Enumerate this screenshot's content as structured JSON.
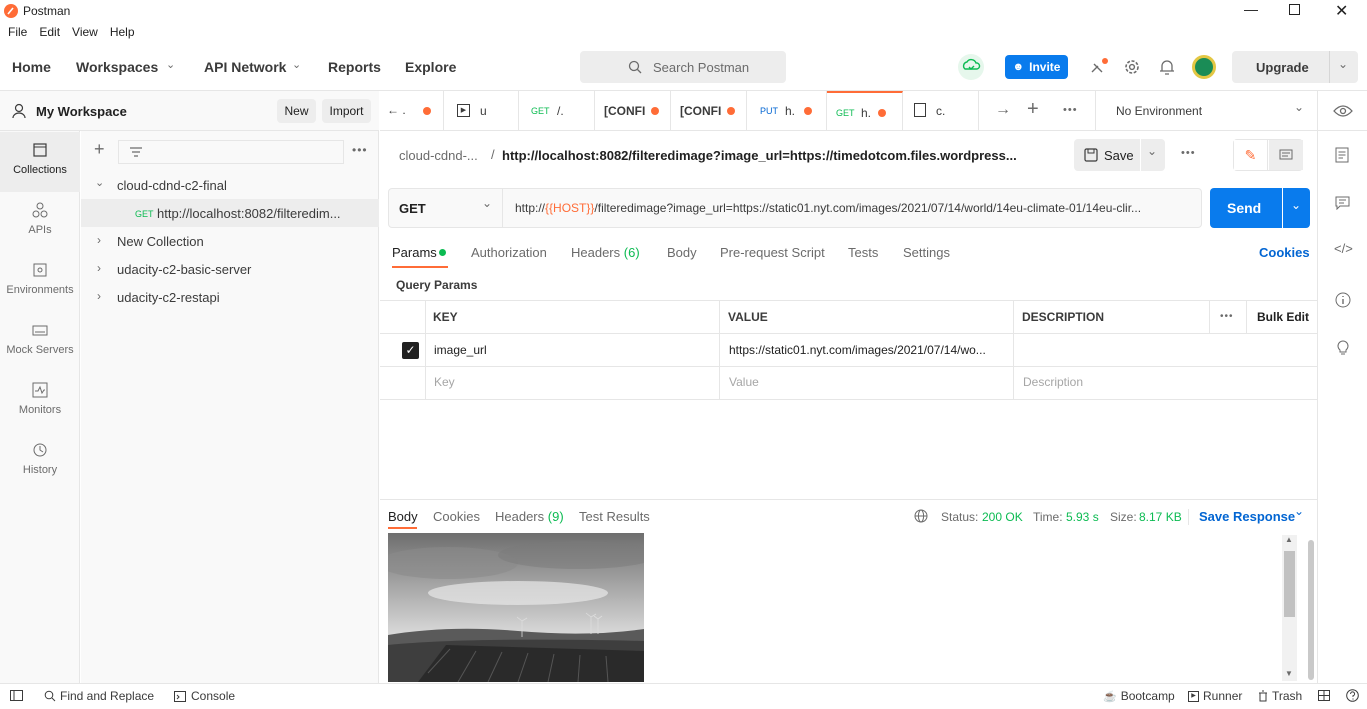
{
  "window": {
    "title": "Postman"
  },
  "menu": [
    "File",
    "Edit",
    "View",
    "Help"
  ],
  "nav": {
    "home": "Home",
    "workspaces": "Workspaces",
    "api_network": "API Network",
    "reports": "Reports",
    "explore": "Explore",
    "search_placeholder": "Search Postman",
    "invite": "Invite",
    "upgrade": "Upgrade"
  },
  "sidebar": {
    "workspace": "My Workspace",
    "new": "New",
    "import": "Import",
    "rail": [
      {
        "label": "Collections"
      },
      {
        "label": "APIs"
      },
      {
        "label": "Environments"
      },
      {
        "label": "Mock Servers"
      },
      {
        "label": "Monitors"
      },
      {
        "label": "History"
      }
    ],
    "tree": [
      {
        "label": "cloud-cdnd-c2-final"
      },
      {
        "method": "GET",
        "label": "http://localhost:8082/filteredim..."
      },
      {
        "label": "New Collection"
      },
      {
        "label": "udacity-c2-basic-server"
      },
      {
        "label": "udacity-c2-restapi"
      }
    ]
  },
  "tabs": [
    {
      "method": "",
      "label": "← ."
    },
    {
      "method": "",
      "label": "u"
    },
    {
      "method": "GET",
      "label": "/."
    },
    {
      "method": "",
      "label": "[CONFI"
    },
    {
      "method": "",
      "label": "[CONFI"
    },
    {
      "method": "PUT",
      "label": "h."
    },
    {
      "method": "GET",
      "label": "h."
    },
    {
      "method": "",
      "label": "c."
    }
  ],
  "environment": "No Environment",
  "request": {
    "breadcrumb_collection": "cloud-cdnd-...",
    "breadcrumb_sep": "/",
    "breadcrumb_name": "http://localhost:8082/filteredimage?image_url=https://timedotcom.files.wordpress...",
    "save": "Save",
    "method": "GET",
    "url_prefix": "http://",
    "url_var": "{{HOST}}",
    "url_rest": "/filteredimage?image_url=https://static01.nyt.com/images/2021/07/14/world/14eu-climate-01/14eu-clir...",
    "send": "Send",
    "tabs": {
      "params": "Params",
      "authorization": "Authorization",
      "headers": "Headers",
      "headers_count": "(6)",
      "body": "Body",
      "prerequest": "Pre-request Script",
      "tests": "Tests",
      "settings": "Settings",
      "cookies": "Cookies"
    },
    "query_params_title": "Query Params",
    "table": {
      "headers": {
        "key": "KEY",
        "value": "VALUE",
        "description": "DESCRIPTION",
        "bulk_edit": "Bulk Edit"
      },
      "rows": [
        {
          "key": "image_url",
          "value": "https://static01.nyt.com/images/2021/07/14/wo...",
          "description": ""
        }
      ],
      "placeholder": {
        "key": "Key",
        "value": "Value",
        "description": "Description"
      }
    }
  },
  "response": {
    "tabs": {
      "body": "Body",
      "cookies": "Cookies",
      "headers": "Headers",
      "headers_count": "(9)",
      "test_results": "Test Results"
    },
    "status_label": "Status:",
    "status": "200 OK",
    "time_label": "Time:",
    "time": "5.93 s",
    "size_label": "Size:",
    "size": "8.17 KB",
    "save_response": "Save Response"
  },
  "footer": {
    "find_replace": "Find and Replace",
    "console": "Console",
    "bootcamp": "Bootcamp",
    "runner": "Runner",
    "trash": "Trash"
  },
  "colors": {
    "accent": "#ff6c37",
    "primary": "#097bed",
    "green": "#0cbb52",
    "get": "#0cbb52",
    "put": "#097bed"
  }
}
